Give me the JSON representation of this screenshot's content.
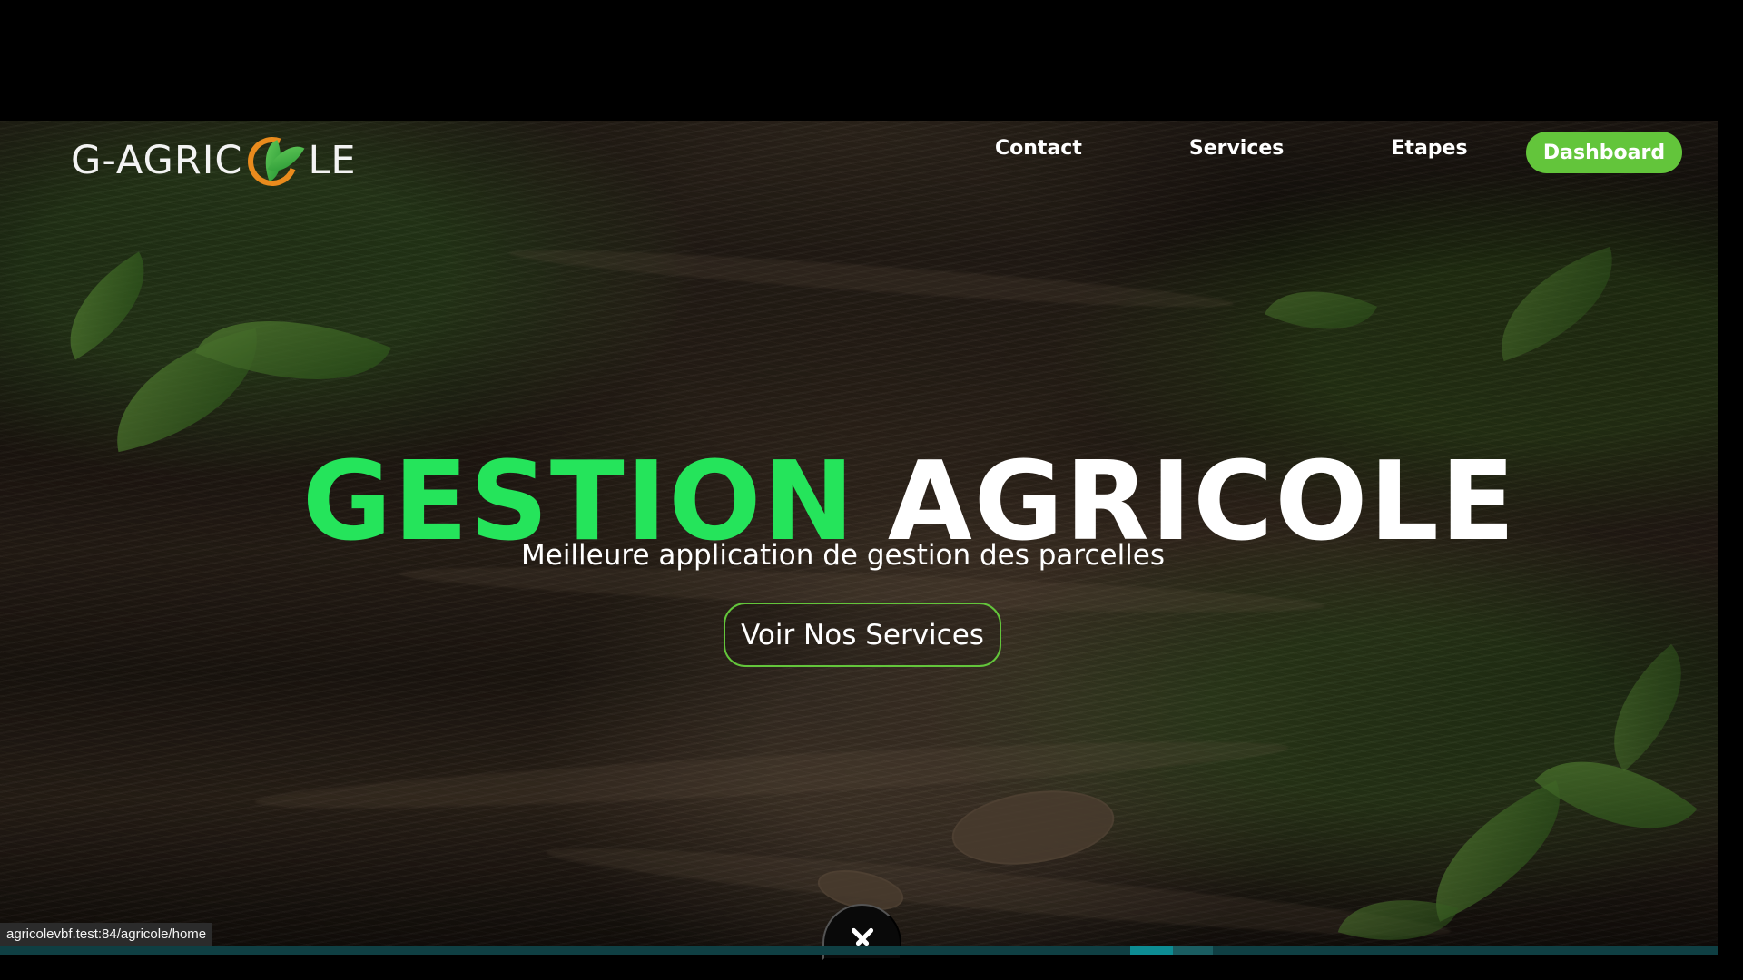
{
  "brand": {
    "left": "G-AGRIC",
    "right": "LE",
    "icon_name": "agriculture-logo-icon"
  },
  "nav": {
    "items": [
      {
        "label": "Contact"
      },
      {
        "label": "Services"
      },
      {
        "label": "Etapes"
      }
    ],
    "dashboard_label": "Dashboard"
  },
  "hero": {
    "title_green": "GESTION",
    "title_white": "AGRICOLE",
    "subtitle": "Meilleure application de gestion des parcelles",
    "cta_label": "Voir Nos Services",
    "scroll_icon_name": "chevron-down-icon"
  },
  "status": {
    "url": "agricolevbf.test:84/agricole/home"
  },
  "colors": {
    "accent_green": "#25e45b",
    "button_green": "#63c53b",
    "logo_orange": "#e98b1d",
    "text_white": "#ffffff",
    "bar_dark": "#0f3f43",
    "bar_accent": "#0d8c93"
  }
}
